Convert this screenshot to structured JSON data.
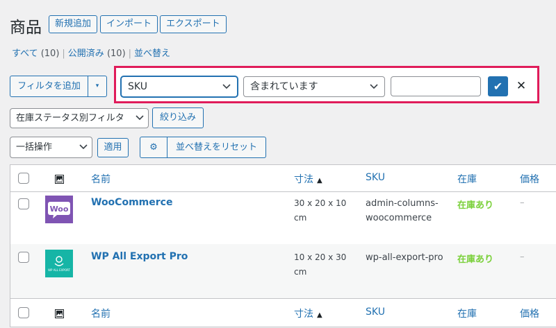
{
  "header": {
    "title": "商品",
    "buttons": {
      "add_new": "新規追加",
      "import": "インポート",
      "export": "エクスポート"
    }
  },
  "views": {
    "all": {
      "label": "すべて",
      "count": "(10)"
    },
    "published": {
      "label": "公開済み",
      "count": "(10)"
    },
    "sort": {
      "label": "並べ替え"
    }
  },
  "filter": {
    "add_filter_label": "フィルタを追加",
    "toggle_icon": "▾",
    "field_select": "SKU",
    "operator_select": "含まれています",
    "value": "",
    "apply_icon": "✔",
    "close_icon": "✕",
    "highlight_color": "#e01b5a"
  },
  "stock_filter": {
    "select": "在庫ステータス別フィルタ",
    "button": "絞り込み"
  },
  "bulk": {
    "select": "一括操作",
    "apply": "適用",
    "gear_icon": "⚙",
    "reset_sort": "並べ替えをリセット"
  },
  "table": {
    "columns": {
      "thumb_icon": "image-icon",
      "name": "名前",
      "dimensions": "寸法",
      "dimensions_sort": "▲",
      "sku": "SKU",
      "stock": "在庫",
      "price": "価格"
    },
    "rows": [
      {
        "name": "WooCommerce",
        "thumb_label": "Woo",
        "thumb_color": "#7f54b3",
        "dimensions_line1": "30 x 20 x 10",
        "dimensions_line2": "cm",
        "sku_line1": "admin-columns-",
        "sku_line2": "woocommerce",
        "stock": "在庫あり",
        "price": "–"
      },
      {
        "name": "WP All Export Pro",
        "thumb_label": "WP ALL EXPORT",
        "thumb_color": "#16b5a6",
        "dimensions_line1": "10 x 20 x 30",
        "dimensions_line2": "cm",
        "sku_line1": "wp-all-export-pro",
        "sku_line2": "",
        "stock": "在庫あり",
        "price": "–"
      }
    ]
  },
  "colors": {
    "accent": "#2271b1",
    "stock_ok": "#7ad03a",
    "background": "#f0f0f1"
  }
}
